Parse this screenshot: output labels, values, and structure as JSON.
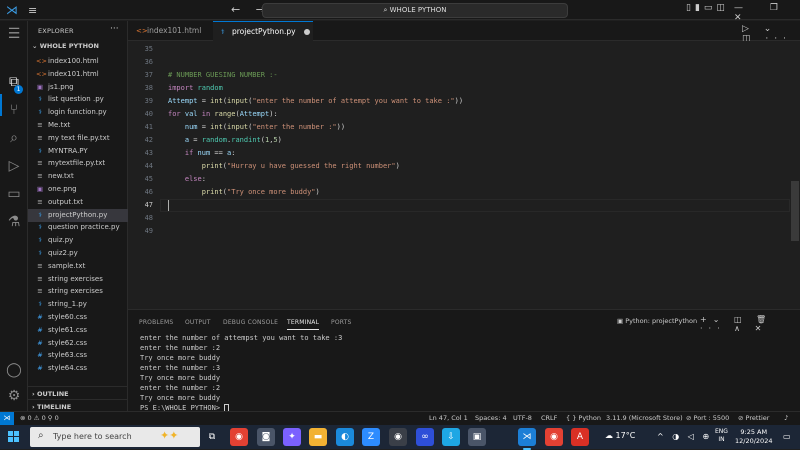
{
  "titlebar": {
    "search_label": "⌕ WHOLE PYTHON",
    "nav": "← →",
    "layout_icons": "▯▮▭◫",
    "window_controls": "— ❐ ✕"
  },
  "activity_bar": {
    "badge_count": "1",
    "items": [
      "menu-icon",
      "explorer-icon",
      "search-icon",
      "source-control-icon",
      "run-debug-icon",
      "remote-explorer-icon",
      "testing-icon",
      "account-icon",
      "settings-icon"
    ]
  },
  "sidebar": {
    "header": "EXPLORER",
    "more": "···",
    "folder": "⌄ WHOLE PYTHON",
    "files": [
      {
        "name": "index100.html",
        "icon": "<>",
        "color": "#e37933"
      },
      {
        "name": "index101.html",
        "icon": "<>",
        "color": "#e37933"
      },
      {
        "name": "js1.png",
        "icon": "▣",
        "color": "#a074c4"
      },
      {
        "name": "list question .py",
        "icon": "⚕",
        "color": "#3b9ee8"
      },
      {
        "name": "login  function.py",
        "icon": "⚕",
        "color": "#3b9ee8"
      },
      {
        "name": "Me.txt",
        "icon": "≡",
        "color": "#cccccc"
      },
      {
        "name": "my text file.py.txt",
        "icon": "≡",
        "color": "#cccccc"
      },
      {
        "name": "MYNTRA.PY",
        "icon": "⚕",
        "color": "#3b9ee8"
      },
      {
        "name": "mytextfile.py.txt",
        "icon": "≡",
        "color": "#cccccc"
      },
      {
        "name": "new.txt",
        "icon": "≡",
        "color": "#cccccc"
      },
      {
        "name": "one.png",
        "icon": "▣",
        "color": "#a074c4"
      },
      {
        "name": "output.txt",
        "icon": "≡",
        "color": "#cccccc"
      },
      {
        "name": "projectPython.py",
        "icon": "⚕",
        "color": "#3b9ee8",
        "selected": true
      },
      {
        "name": "question practice.py",
        "icon": "⚕",
        "color": "#3b9ee8"
      },
      {
        "name": "quiz.py",
        "icon": "⚕",
        "color": "#3b9ee8"
      },
      {
        "name": "quiz2.py",
        "icon": "⚕",
        "color": "#3b9ee8"
      },
      {
        "name": "sample.txt",
        "icon": "≡",
        "color": "#cccccc"
      },
      {
        "name": "string exercises",
        "icon": "≡",
        "color": "#cccccc"
      },
      {
        "name": "string exercises",
        "icon": "≡",
        "color": "#cccccc"
      },
      {
        "name": "string_1.py",
        "icon": "⚕",
        "color": "#3b9ee8"
      },
      {
        "name": "style60.css",
        "icon": "#",
        "color": "#42a5f5"
      },
      {
        "name": "style61.css",
        "icon": "#",
        "color": "#42a5f5"
      },
      {
        "name": "style62.css",
        "icon": "#",
        "color": "#42a5f5"
      },
      {
        "name": "style63.css",
        "icon": "#",
        "color": "#42a5f5"
      },
      {
        "name": "style64.css",
        "icon": "#",
        "color": "#42a5f5"
      }
    ],
    "outline": "› OUTLINE",
    "timeline": "› TIMELINE"
  },
  "tabs": [
    {
      "label": "index101.html",
      "icon": "<>",
      "color": "#e37933",
      "active": false
    },
    {
      "label": "projectPython.py",
      "icon": "⚕",
      "color": "#3b9ee8",
      "active": true
    }
  ],
  "tab_actions": "▷ ⌄ ◫ ···",
  "editor": {
    "lines": [
      {
        "n": "35",
        "code": ""
      },
      {
        "n": "36",
        "code": ""
      },
      {
        "n": "37",
        "code": "# NUMBER GUESING NUMBER :-"
      },
      {
        "n": "38",
        "code": "import random"
      },
      {
        "n": "39",
        "code": "Attempt = int(input(\"enter the number of attempt you want to take :\"))"
      },
      {
        "n": "40",
        "code": "for val in range(Attempt):"
      },
      {
        "n": "41",
        "code": "    num = int(input(\"enter the number :\"))"
      },
      {
        "n": "42",
        "code": "    a = random.randint(1,5)"
      },
      {
        "n": "43",
        "code": "    if num == a:"
      },
      {
        "n": "44",
        "code": "        print(\"Hurray u have guessed the right number\")"
      },
      {
        "n": "45",
        "code": "    else:"
      },
      {
        "n": "46",
        "code": "        print(\"Try once more buddy\")"
      },
      {
        "n": "47",
        "code": ""
      },
      {
        "n": "48",
        "code": ""
      },
      {
        "n": "49",
        "code": ""
      }
    ],
    "current_line": "47"
  },
  "panel": {
    "tabs": [
      "PROBLEMS",
      "OUTPUT",
      "DEBUG CONSOLE",
      "TERMINAL",
      "PORTS"
    ],
    "active_tab": "TERMINAL",
    "terminal_name": "▣ Python: projectPython",
    "actions": "+⌄ ◫ 🗑 ··· ∧ ✕",
    "terminal_lines": [
      "enter the number of attempst you want to take :3",
      "enter the number :2",
      "Try once more buddy",
      "enter the number :3",
      "Try once more buddy",
      "enter the number :2",
      "Try once more buddy"
    ],
    "prompt": "PS E:\\WHOLE PYTHON> "
  },
  "statusbar": {
    "remote": "⋊",
    "problems": "⊗ 0  ⚠ 0   ⚲ 0",
    "position": "Ln 47, Col 1",
    "spaces": "Spaces: 4",
    "encoding": "UTF-8",
    "eol": "CRLF",
    "language": "{ } Python",
    "interpreter": "3.11.9 (Microsoft Store)",
    "port": "⊘ Port : 5500",
    "prettier": "⊘ Prettier",
    "bell": "♪"
  },
  "taskbar": {
    "search_placeholder": "Type here to search",
    "weather_temp": "17°C",
    "lang_top": "ENG",
    "lang_bottom": "IN",
    "time": "9:25 AM",
    "date": "12/20/2024",
    "apps": [
      {
        "name": "task-view-icon",
        "glyph": "⧉",
        "bg": "transparent"
      },
      {
        "name": "chrome-icon",
        "glyph": "◉",
        "bg": "#e34133"
      },
      {
        "name": "camera-app-icon",
        "glyph": "◙",
        "bg": "#4a5568"
      },
      {
        "name": "copilot-icon",
        "glyph": "✦",
        "bg": "#7b61ff"
      },
      {
        "name": "file-explorer-icon",
        "glyph": "▬",
        "bg": "#f2b233"
      },
      {
        "name": "edge-icon",
        "glyph": "◐",
        "bg": "#1b8adb"
      },
      {
        "name": "zoom-app-icon",
        "glyph": "Z",
        "bg": "#2d8cff"
      },
      {
        "name": "chrome-alt-icon",
        "glyph": "◉",
        "bg": "#3a3f48"
      },
      {
        "name": "app-blue-icon",
        "glyph": "∞",
        "bg": "#2e4fd8"
      },
      {
        "name": "download-app-icon",
        "glyph": "⇩",
        "bg": "#1ea7e4"
      },
      {
        "name": "teams-icon",
        "glyph": "▣",
        "bg": "#4a5568"
      },
      {
        "name": "vscode-icon",
        "glyph": "⋊",
        "bg": "#1c7fd6"
      },
      {
        "name": "chrome-profile-icon",
        "glyph": "◉",
        "bg": "#e34133"
      },
      {
        "name": "pdf-app-icon",
        "glyph": "A",
        "bg": "#d93025"
      }
    ],
    "tray": "^ ◑ ◁ ⊕"
  }
}
